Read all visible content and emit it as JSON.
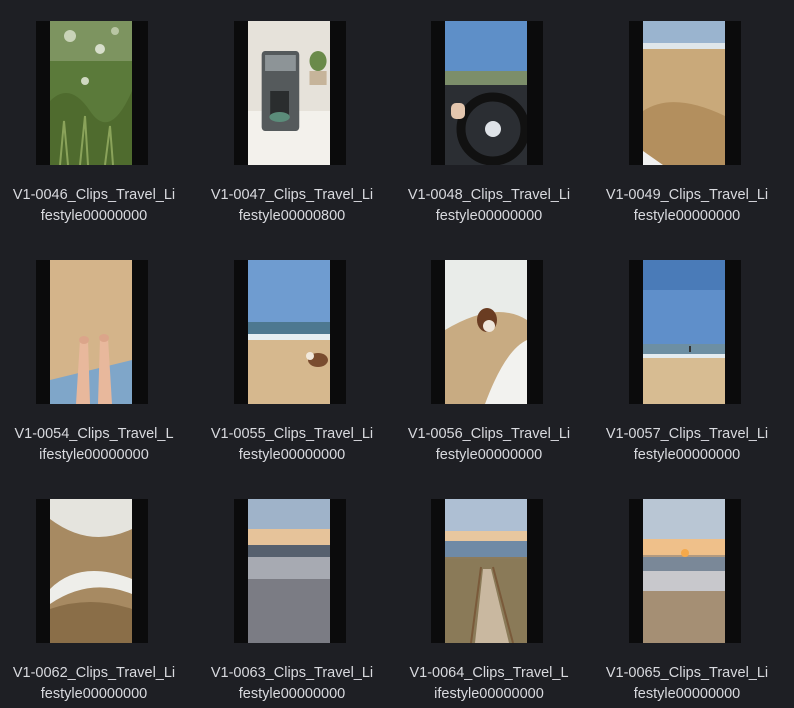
{
  "window": {
    "background": "#1e1f24",
    "text_color": "#d9dadf"
  },
  "files": [
    {
      "line1": "V1-0046_Clips_Travel_Li",
      "line2": "festyle00000000",
      "thumb": "grass"
    },
    {
      "line1": "V1-0047_Clips_Travel_Li",
      "line2": "festyle00000800",
      "thumb": "coffee-machine"
    },
    {
      "line1": "V1-0048_Clips_Travel_Li",
      "line2": "festyle00000000",
      "thumb": "car-steering-wheel"
    },
    {
      "line1": "V1-0049_Clips_Travel_Li",
      "line2": "festyle00000000",
      "thumb": "sand-beach"
    },
    {
      "line1": "V1-0054_Clips_Travel_L",
      "line2": "ifestyle00000000",
      "thumb": "legs-on-sand"
    },
    {
      "line1": "V1-0055_Clips_Travel_Li",
      "line2": "festyle00000000",
      "thumb": "dog-on-beach"
    },
    {
      "line1": "V1-0056_Clips_Travel_Li",
      "line2": "festyle00000000",
      "thumb": "dog-in-surf"
    },
    {
      "line1": "V1-0057_Clips_Travel_Li",
      "line2": "festyle00000000",
      "thumb": "beach-sky"
    },
    {
      "line1": "V1-0062_Clips_Travel_Li",
      "line2": "festyle00000000",
      "thumb": "foam-waves"
    },
    {
      "line1": "V1-0063_Clips_Travel_Li",
      "line2": "festyle00000000",
      "thumb": "sunset-sea"
    },
    {
      "line1": "V1-0064_Clips_Travel_L",
      "line2": "ifestyle00000000",
      "thumb": "boardwalk-stairs"
    },
    {
      "line1": "V1-0065_Clips_Travel_Li",
      "line2": "festyle00000000",
      "thumb": "sunset-beach"
    }
  ]
}
